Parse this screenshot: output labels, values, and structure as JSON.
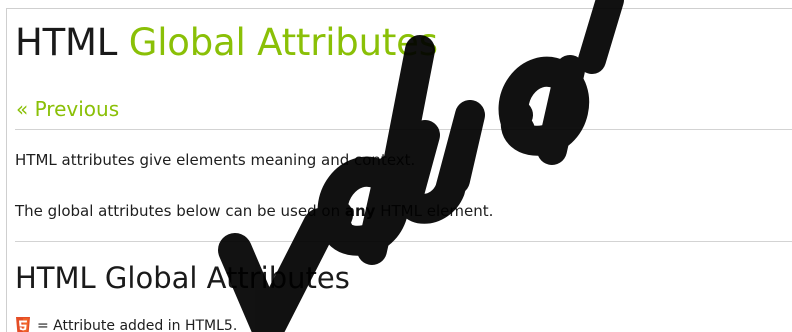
{
  "page": {
    "title_prefix": "HTML ",
    "title_accent": "Global Attributes",
    "accent_color": "#8ac007"
  },
  "nav": {
    "previous_label": "« Previous"
  },
  "intro": {
    "paragraph_1": "HTML attributes give elements meaning and context.",
    "paragraph_2_before": "The global attributes below can be used on ",
    "paragraph_2_bold": "any",
    "paragraph_2_after": " HTML element."
  },
  "section": {
    "title": "HTML Global Attributes"
  },
  "legend": {
    "icon": "html5-icon",
    "text": "= Attribute added in HTML5."
  },
  "watermark": {
    "color": "#000000"
  }
}
